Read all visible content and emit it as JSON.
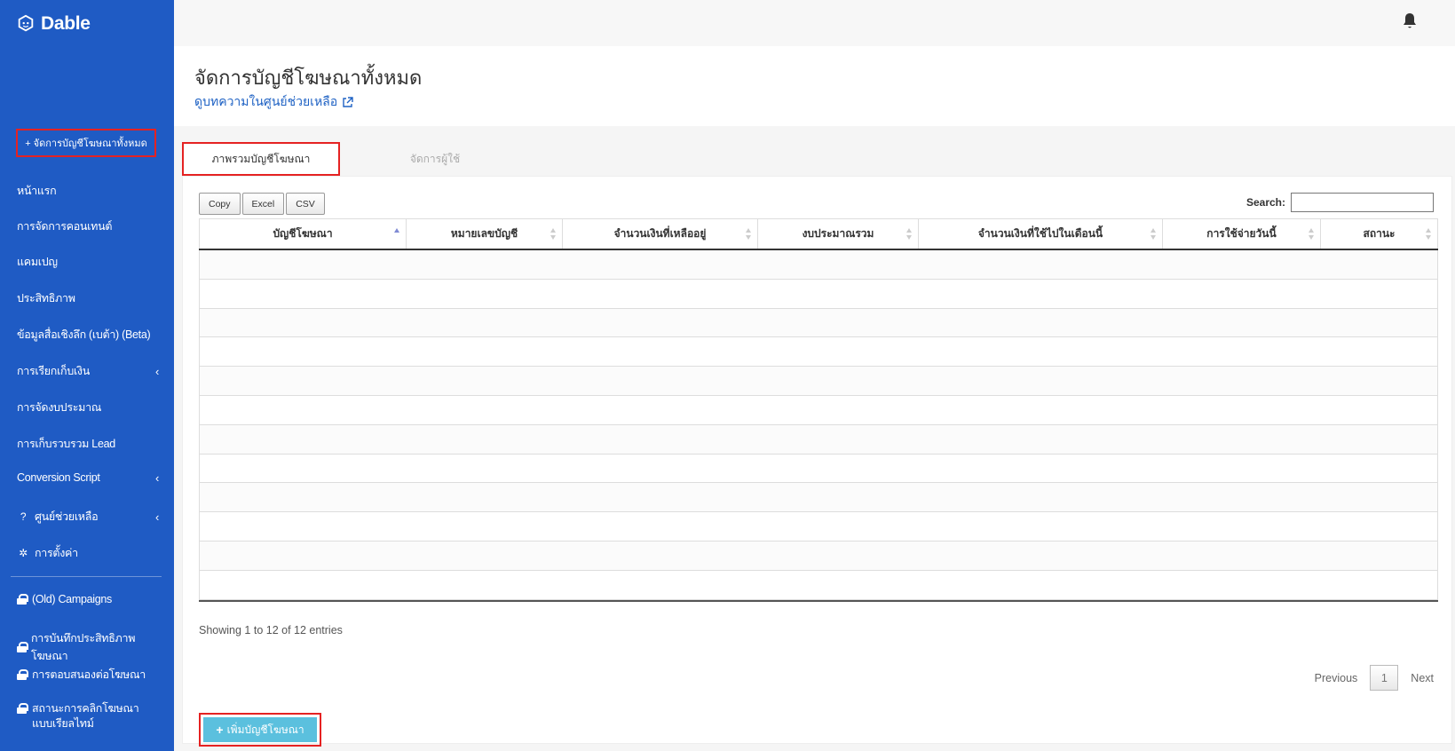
{
  "sidebar": {
    "brand": "Dable",
    "cta": "+ จัดการบัญชีโฆษณาทั้งหมด",
    "items": [
      {
        "label": "หน้าแรก"
      },
      {
        "label": "การจัดการคอนเทนต์"
      },
      {
        "label": "แคมเปญ"
      },
      {
        "label": "ประสิทธิภาพ"
      },
      {
        "label": "ข้อมูลสื่อเชิงลึก (เบต้า) (Beta)"
      },
      {
        "label": "การเรียกเก็บเงิน"
      },
      {
        "label": "การจัดงบประมาณ"
      },
      {
        "label": "การเก็บรวบรวม Lead"
      },
      {
        "label": "Conversion Script"
      },
      {
        "label": "ศูนย์ช่วยเหลือ"
      },
      {
        "label": "การตั้งค่า"
      }
    ],
    "locked_items": [
      {
        "label": "(Old) Campaigns"
      },
      {
        "label": "การบันทึกประสิทธิภาพโฆษณา"
      },
      {
        "label": "การตอบสนองต่อโฆษณา"
      },
      {
        "label": "สถานะการคลิกโฆษณาแบบเรียลไทม์"
      }
    ]
  },
  "header": {
    "title": "จัดการบัญชีโฆษณาทั้งหมด",
    "help_link": "ดูบทความในศูนย์ช่วยเหลือ"
  },
  "tabs": [
    {
      "label": "ภาพรวมบัญชีโฆษณา",
      "active": true
    },
    {
      "label": "จัดการผู้ใช้",
      "active": false
    }
  ],
  "toolbar": {
    "buttons": [
      "Copy",
      "Excel",
      "CSV"
    ],
    "search_label": "Search:",
    "search_value": ""
  },
  "table": {
    "columns": [
      "บัญชีโฆษณา",
      "หมายเลขบัญชี",
      "จำนวนเงินที่เหลืออยู่",
      "งบประมาณรวม",
      "จำนวนเงินที่ใช้ไปในเดือนนี้",
      "การใช้จ่ายวันนี้",
      "สถานะ"
    ],
    "row_count": 12
  },
  "footer": {
    "info": "Showing 1 to 12 of 12 entries",
    "previous": "Previous",
    "page": "1",
    "next": "Next",
    "add_button": "เพิ่มบัญชีโฆษณา"
  },
  "colors": {
    "sidebar": "#1f5bc4",
    "highlight": "#e52222",
    "add_button": "#5bc0de",
    "link": "#1f62c4"
  }
}
